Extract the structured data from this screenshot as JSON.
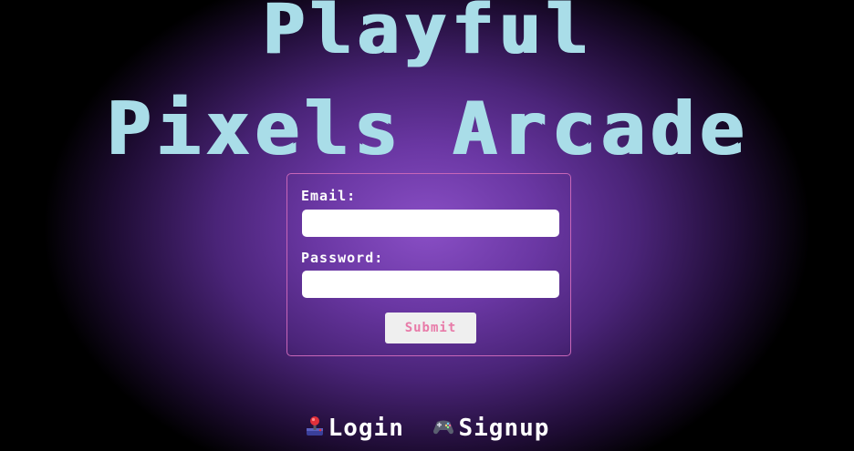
{
  "header": {
    "title_line1": "Playful",
    "title_line2": "Pixels Arcade"
  },
  "form": {
    "email_label": "Email:",
    "email_value": "",
    "password_label": "Password:",
    "password_value": "",
    "submit_label": "Submit"
  },
  "nav": {
    "login_icon": "joystick-icon",
    "login_label": "Login",
    "signup_icon": "gamepad-icon",
    "signup_label": "Signup"
  },
  "colors": {
    "title": "#a9dde8",
    "form_border": "#c766b8",
    "submit_text": "#e87aa8",
    "background_center": "#8a4fc6"
  }
}
